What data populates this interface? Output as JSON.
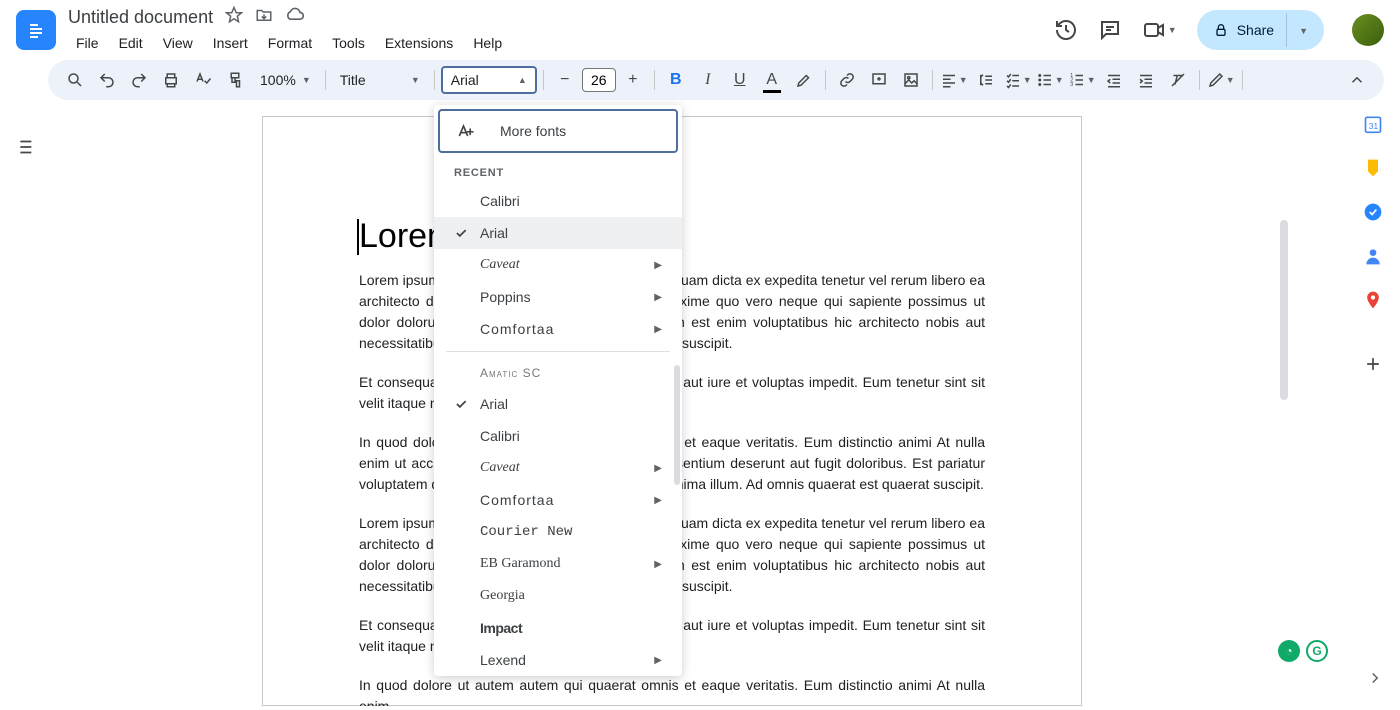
{
  "header": {
    "doc_title": "Untitled document",
    "menus": [
      "File",
      "Edit",
      "View",
      "Insert",
      "Format",
      "Tools",
      "Extensions",
      "Help"
    ],
    "share_label": "Share"
  },
  "toolbar": {
    "zoom": "100%",
    "style": "Title",
    "font": "Arial",
    "font_size": "26"
  },
  "font_menu": {
    "more_fonts": "More fonts",
    "recent_label": "RECENT",
    "recent": [
      {
        "name": "Calibri",
        "checked": false,
        "cls": "",
        "arrow": false
      },
      {
        "name": "Arial",
        "checked": true,
        "cls": "",
        "arrow": false,
        "selected": true
      },
      {
        "name": "Caveat",
        "checked": false,
        "cls": "caveat",
        "arrow": true
      },
      {
        "name": "Poppins",
        "checked": false,
        "cls": "poppins",
        "arrow": true
      },
      {
        "name": "Comfortaa",
        "checked": false,
        "cls": "comfortaa",
        "arrow": true
      }
    ],
    "all": [
      {
        "name": "Amatic SC",
        "checked": false,
        "cls": "amatic",
        "arrow": false
      },
      {
        "name": "Arial",
        "checked": true,
        "cls": "",
        "arrow": false
      },
      {
        "name": "Calibri",
        "checked": false,
        "cls": "",
        "arrow": false
      },
      {
        "name": "Caveat",
        "checked": false,
        "cls": "caveat",
        "arrow": true
      },
      {
        "name": "Comfortaa",
        "checked": false,
        "cls": "comfortaa",
        "arrow": true
      },
      {
        "name": "Courier New",
        "checked": false,
        "cls": "courier",
        "arrow": false
      },
      {
        "name": "EB Garamond",
        "checked": false,
        "cls": "ebg",
        "arrow": true
      },
      {
        "name": "Georgia",
        "checked": false,
        "cls": "georgia",
        "arrow": false
      },
      {
        "name": "Impact",
        "checked": false,
        "cls": "impact",
        "arrow": false
      },
      {
        "name": "Lexend",
        "checked": false,
        "cls": "",
        "arrow": true
      }
    ]
  },
  "document": {
    "title": "Lorem",
    "p1": "Lorem ipsum dolor sit amet. Hic dolor minus et illo quam dicta ex expedita tenetur vel rerum libero ea architecto deserunt ut beatae velit. Vel aliquid maxime quo vero neque qui sapiente possimus ut dolor dolorum. Eum assumenda iure id odit ipsum est enim voluptatibus hic architecto nobis aut necessitatibus libero est quasi perspiciatis aut unde suscipit.",
    "p2": "Et consequatur similique qui assumenda obcaecati aut iure et voluptas impedit. Eum tenetur sint sit velit itaque non culpa quia.",
    "p3": "In quod dolore ut autem autem qui quaerat omnis et eaque veritatis. Eum distinctio animi At nulla enim ut accusamus eum alius distincti nisi id praesentium deserunt aut fugit doloribus. Est pariatur voluptatem qui fugiat quasi sit accusantium nam minima illum. Ad omnis quaerat est quaerat suscipit.",
    "p4": "Lorem ipsum dolor sit amet. Hic dolor minus et illo quam dicta ex expedita tenetur vel rerum libero ea architecto deserunt ut beatae velit. Vel aliquid maxime quo vero neque qui sapiente possimus ut dolor dolorum. Eum assumenda iure id odit ipsum est enim voluptatibus hic architecto nobis aut necessitatibus libero est quasi perspiciatis aut unde suscipit.",
    "p5": "Et consequatur similique qui assumenda obcaecati aut iure et voluptas impedit. Eum tenetur sint sit velit itaque non culpa quia.",
    "p6": "In quod dolore ut autem autem qui quaerat omnis et eaque veritatis. Eum distinctio animi At nulla enim"
  }
}
